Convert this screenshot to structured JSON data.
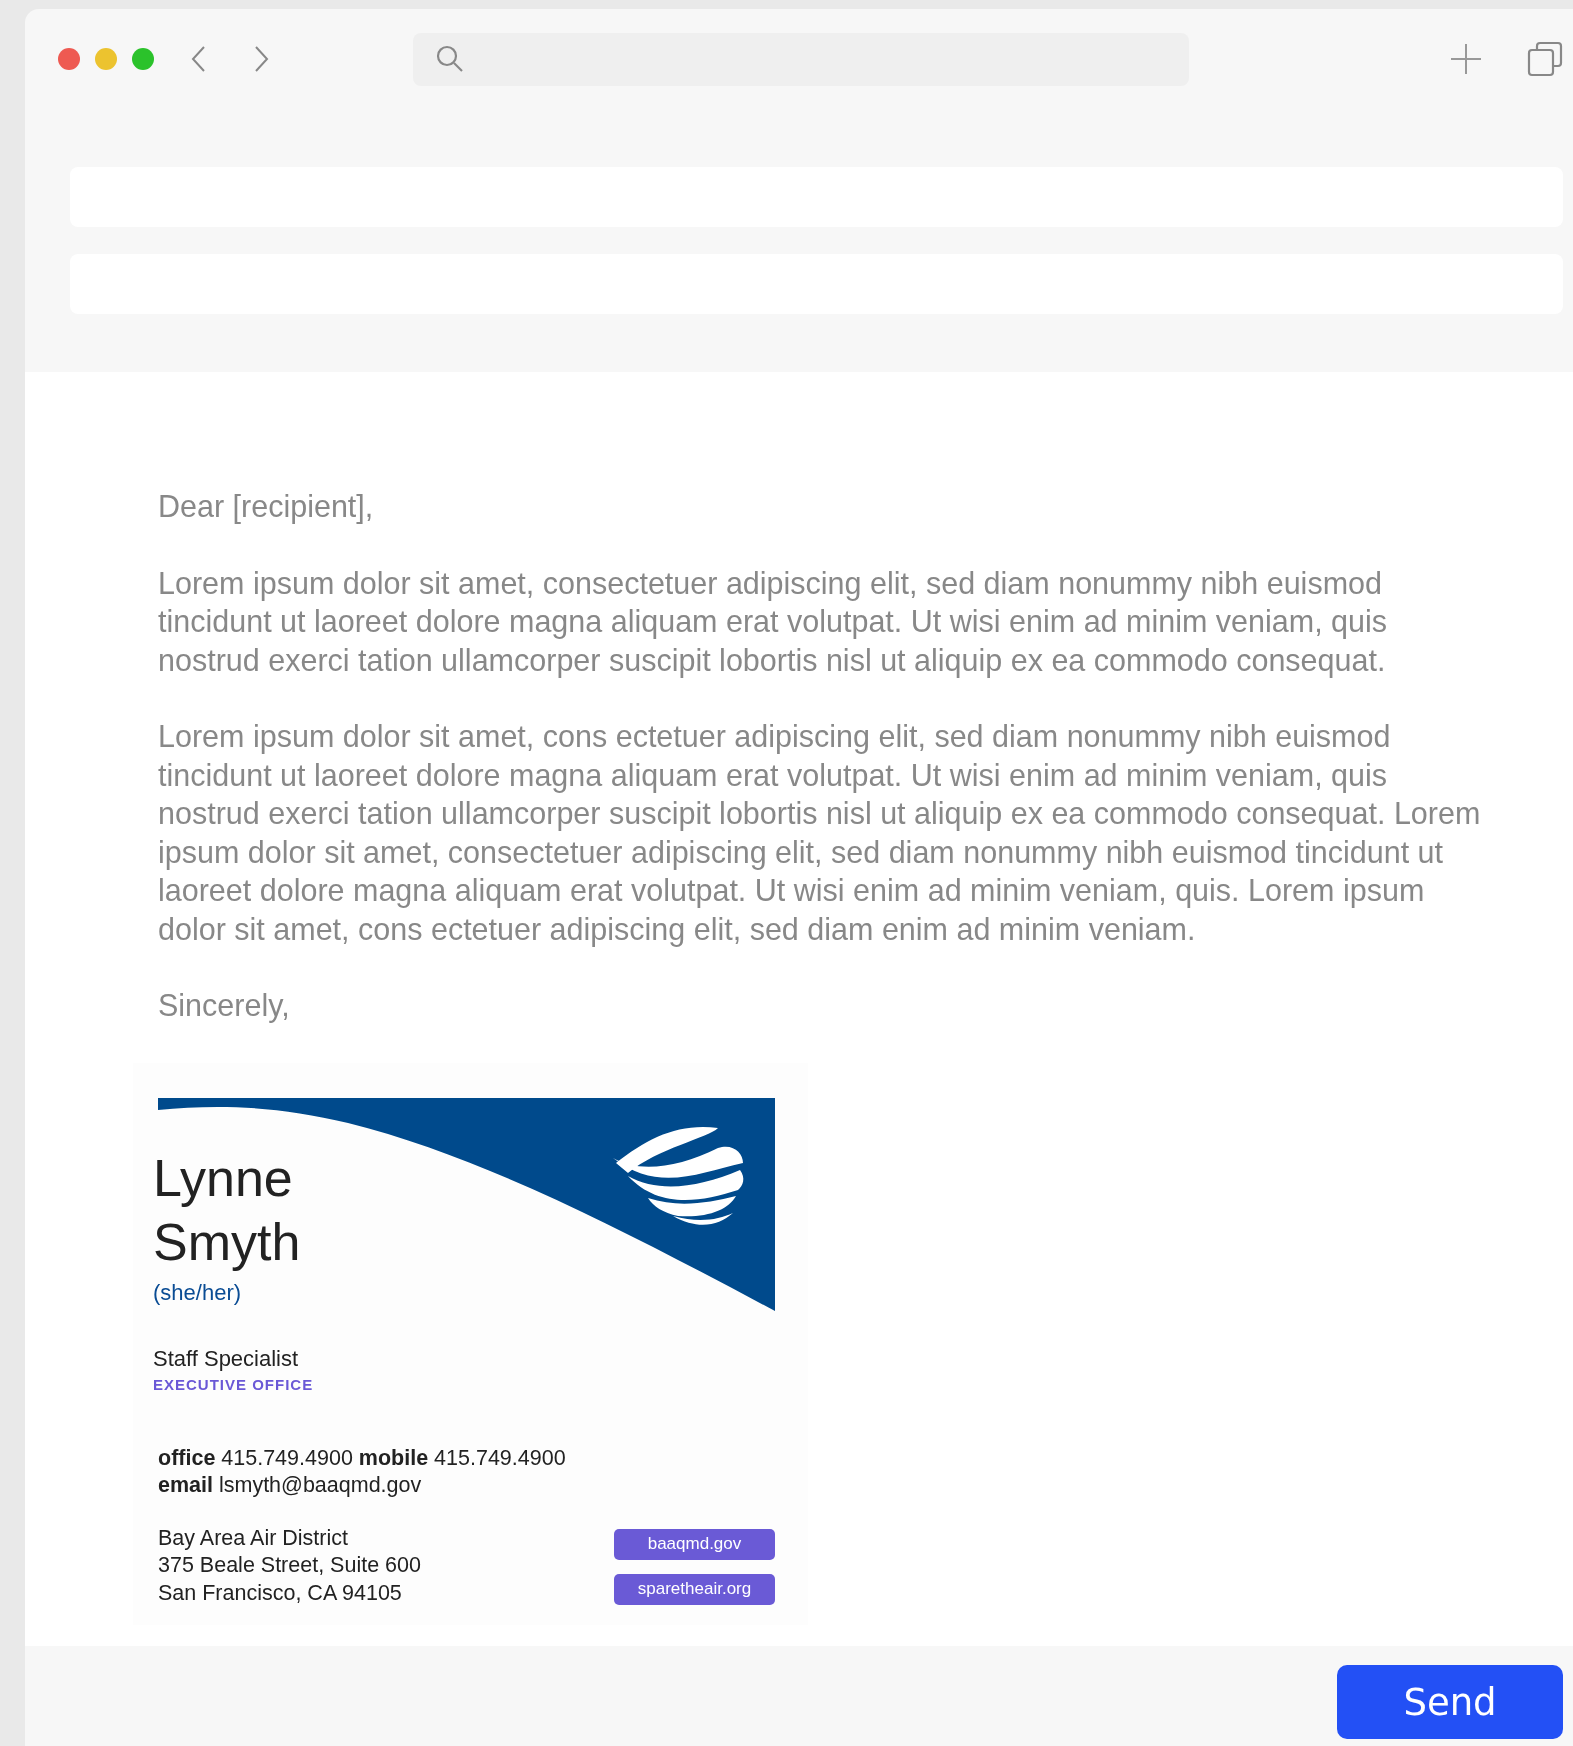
{
  "letter": {
    "greeting": "Dear [recipient],",
    "paragraphs": [
      "Lorem ipsum dolor sit amet, consectetuer adipiscing elit, sed diam nonummy nibh euismod tincidunt ut laoreet dolore magna aliquam erat volutpat. Ut wisi enim ad minim veniam, quis nostrud exerci tation ullamcorper suscipit lobortis nisl ut aliquip ex ea commodo consequat.",
      "Lorem ipsum dolor sit amet, cons ectetuer adipiscing elit, sed diam nonummy nibh euismod tincidunt ut laoreet dolore magna aliquam erat volutpat. Ut wisi enim ad minim veniam, quis nostrud exerci tation ullamcorper suscipit lobortis nisl ut aliquip ex ea commodo consequat. Lorem ipsum dolor sit amet, consectetuer adipiscing elit, sed diam nonummy nibh euismod tincidunt ut laoreet dolore magna aliquam erat volutpat. Ut wisi enim ad minim veniam, quis. Lorem ipsum dolor sit amet, cons ectetuer adipiscing elit, sed diam enim ad minim veniam."
    ],
    "closing": "Sincerely,"
  },
  "signature": {
    "first_name": "Lynne",
    "last_name": "Smyth",
    "pronouns": "(she/her)",
    "title": "Staff Specialist",
    "department": "EXECUTIVE OFFICE",
    "contact": [
      "**office** 415.749.4900  **mobile** 415.749.4900",
      "**email** lsmyth@baaqmd.gov"
    ],
    "address": [
      "Bay Area Air District",
      "375 Beale Street, Suite 600",
      "San Francisco, CA 94105"
    ],
    "links": [
      "baaqmd.gov",
      "sparetheair.org"
    ]
  },
  "send_button": "Send"
}
